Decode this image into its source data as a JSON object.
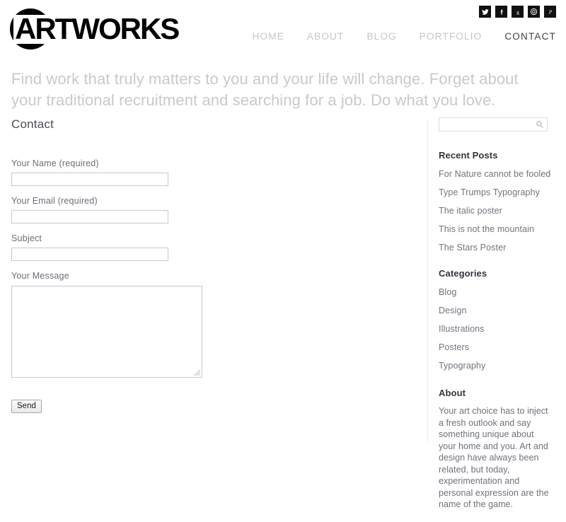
{
  "site": {
    "logo_text": "ARTWORKS",
    "logo_mark": "black-circle"
  },
  "header": {
    "social": [
      {
        "name": "twitter",
        "glyph": "twitter-icon",
        "label": "Twitter"
      },
      {
        "name": "facebook",
        "glyph": "facebook-icon",
        "label": "f"
      },
      {
        "name": "google-plus",
        "glyph": "google-plus-icon",
        "label": "g"
      },
      {
        "name": "instagram",
        "glyph": "instagram-icon",
        "label": "Instagram"
      },
      {
        "name": "pinterest",
        "glyph": "pinterest-icon",
        "label": "P"
      }
    ],
    "nav": [
      {
        "label": "HOME",
        "active": false
      },
      {
        "label": "ABOUT",
        "active": false
      },
      {
        "label": "BLOG",
        "active": false
      },
      {
        "label": "PORTFOLIO",
        "active": false
      },
      {
        "label": "CONTACT",
        "active": true
      }
    ]
  },
  "tagline": "Find work that truly matters to you and your life will change. Forget about your traditional recruitment and searching for a job. Do what you love.",
  "main": {
    "page_title": "Contact",
    "form": {
      "name_label": "Your Name (required)",
      "name_value": "",
      "name_placeholder": "",
      "email_label": "Your Email (required)",
      "email_value": "",
      "email_placeholder": "",
      "subject_label": "Subject",
      "subject_value": "",
      "subject_placeholder": "",
      "message_label": "Your Message",
      "message_value": "",
      "message_placeholder": "",
      "submit_label": "Send"
    }
  },
  "sidebar": {
    "search": {
      "value": "",
      "placeholder": "",
      "icon": "search-icon"
    },
    "recent_posts": {
      "title": "Recent Posts",
      "items": [
        "For Nature cannot be fooled",
        "Type Trumps Typography",
        "The italic poster",
        "This is not the mountain",
        "The Stars Poster"
      ]
    },
    "categories": {
      "title": "Categories",
      "items": [
        "Blog",
        "Design",
        "Illustrations",
        "Posters",
        "Typography"
      ]
    },
    "about": {
      "title": "About",
      "text": "Your art choice has to inject a fresh outlook and say something unique about your home and you. Art and design have always been related, but today, experimentation and personal expression are the name of the game."
    }
  },
  "colors": {
    "accent_dark": "#000000",
    "nav_inactive": "#c4c6cb",
    "nav_active": "#3d4148",
    "tagline": "#c8cace",
    "body_text": "#6d727b",
    "border": "#c9c9c9"
  }
}
